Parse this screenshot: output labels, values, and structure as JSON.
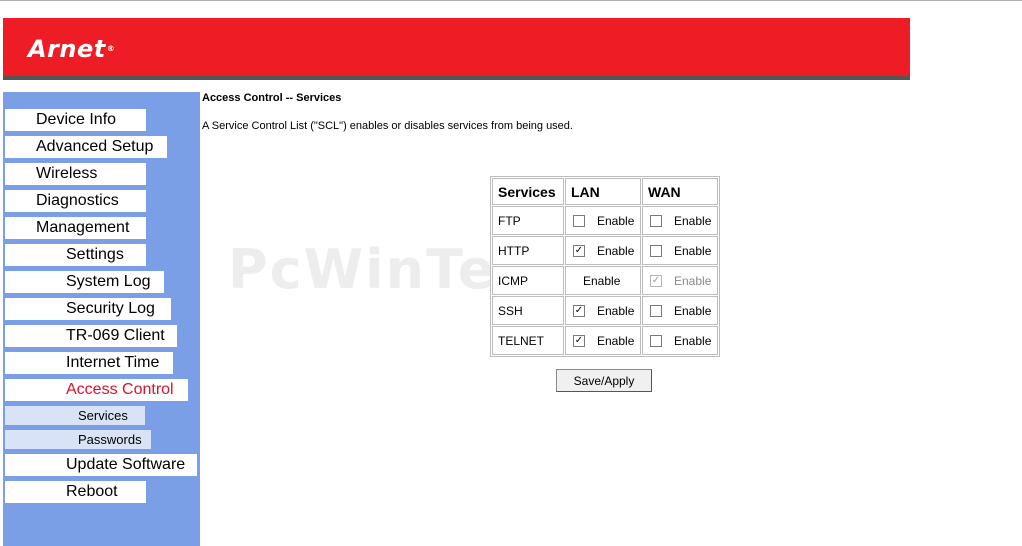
{
  "header": {
    "logo_text": "Arnet",
    "logo_mark": "®",
    "brand_color": "#ee1c25"
  },
  "sidebar": {
    "background": "#7b9fe6",
    "items": [
      {
        "label": "Device Info"
      },
      {
        "label": "Advanced Setup"
      },
      {
        "label": "Wireless"
      },
      {
        "label": "Diagnostics"
      },
      {
        "label": "Management"
      },
      {
        "label": "Settings"
      },
      {
        "label": "System Log"
      },
      {
        "label": "Security Log"
      },
      {
        "label": "TR-069 Client"
      },
      {
        "label": "Internet Time"
      },
      {
        "label": "Access Control",
        "active": true
      },
      {
        "label": "Services"
      },
      {
        "label": "Passwords"
      },
      {
        "label": "Update Software"
      },
      {
        "label": "Reboot"
      }
    ]
  },
  "main": {
    "title": "Access Control -- Services",
    "description": "A Service Control List (\"SCL\") enables or disables services from being used.",
    "table": {
      "headers": [
        "Services",
        "LAN",
        "WAN"
      ],
      "option_label": "Enable",
      "rows": [
        {
          "service": "FTP",
          "lan_checked": false,
          "wan_checked": false
        },
        {
          "service": "HTTP",
          "lan_checked": true,
          "wan_checked": false
        },
        {
          "service": "ICMP",
          "lan_checked": null,
          "wan_checked": true,
          "lan_text": "Enable",
          "wan_disabled": true
        },
        {
          "service": "SSH",
          "lan_checked": true,
          "wan_checked": false
        },
        {
          "service": "TELNET",
          "lan_checked": true,
          "wan_checked": false
        }
      ]
    },
    "save_label": "Save/Apply"
  },
  "watermark": "PcWinTech.com"
}
